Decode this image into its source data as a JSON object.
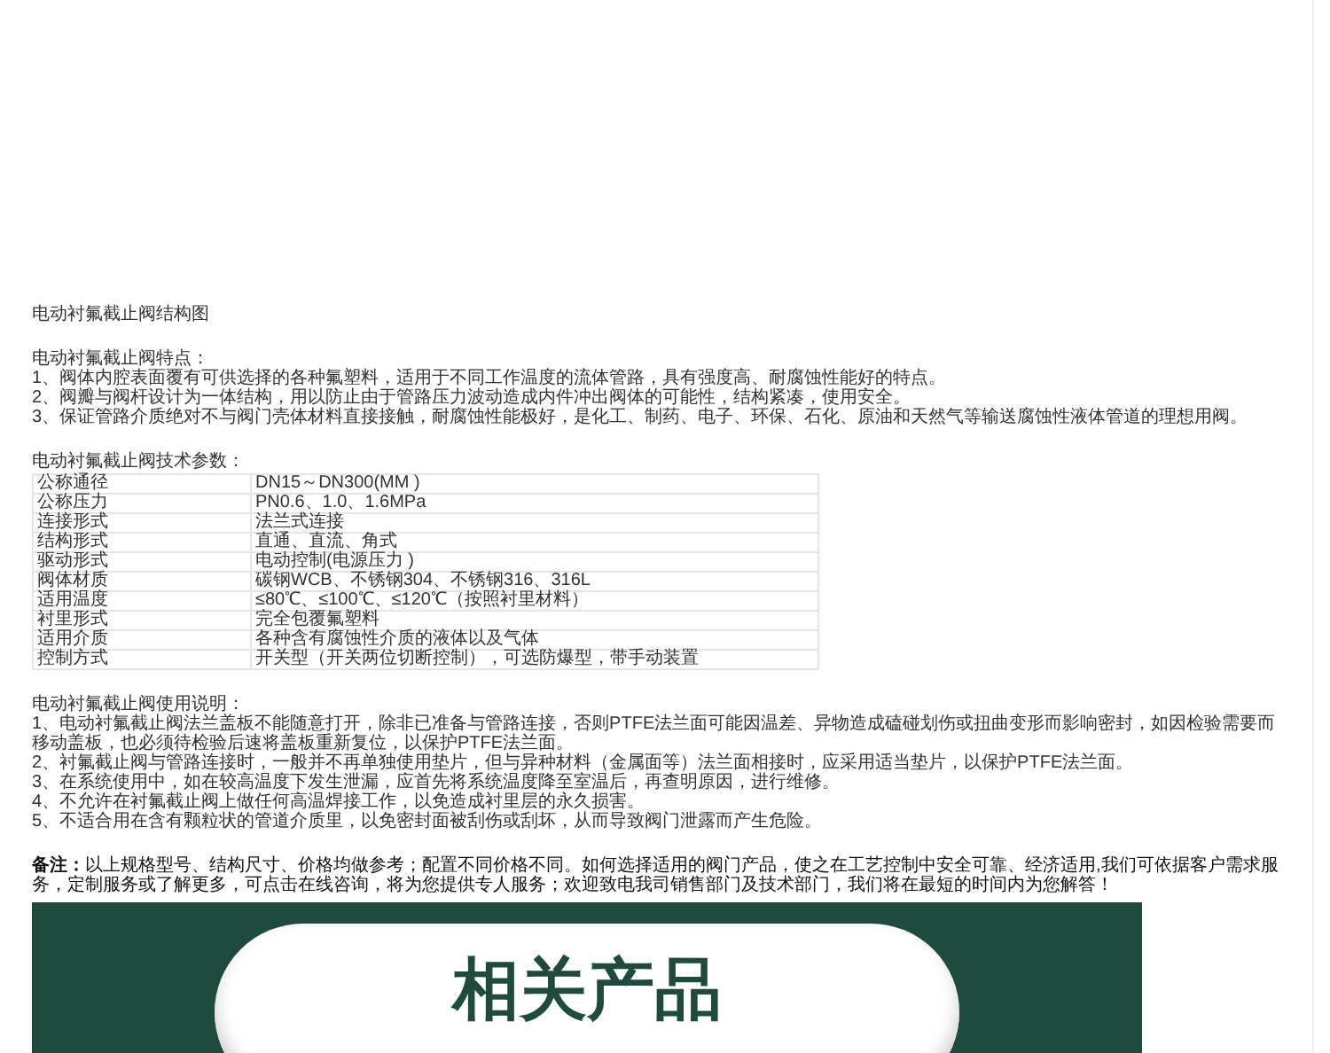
{
  "diagram_heading": "电动衬氟截止阀结构图",
  "features": {
    "title": "电动衬氟截止阀特点：",
    "items": [
      "1、阀体内腔表面覆有可供选择的各种氟塑料，适用于不同工作温度的流体管路，具有强度高、耐腐蚀性能好的特点。",
      "2、阀瓣与阀杆设计为一体结构，用以防止由于管路压力波动造成内件冲出阀体的可能性，结构紧凑，使用安全。",
      "3、保证管路介质绝对不与阀门壳体材料直接接触，耐腐蚀性能极好，是化工、制药、电子、环保、石化、原油和天然气等输送腐蚀性液体管道的理想用阀。"
    ]
  },
  "specs": {
    "title": "电动衬氟截止阀技术参数：",
    "rows": [
      {
        "label": "公称通径",
        "value": "DN15～DN300(MM )"
      },
      {
        "label": "公称压力",
        "value": "PN0.6、1.0、1.6MPa"
      },
      {
        "label": "连接形式",
        "value": "法兰式连接"
      },
      {
        "label": "结构形式",
        "value": "直通、直流、角式"
      },
      {
        "label": "驱动形式",
        "value": "电动控制(电源压力 )"
      },
      {
        "label": "阀体材质",
        "value": "碳钢WCB、不锈钢304、不锈钢316、316L"
      },
      {
        "label": "适用温度",
        "value": "≤80℃、≤100℃、≤120℃（按照衬里材料）"
      },
      {
        "label": "衬里形式",
        "value": "完全包覆氟塑料"
      },
      {
        "label": "适用介质",
        "value": "各种含有腐蚀性介质的液体以及气体"
      },
      {
        "label": "控制方式",
        "value": "开关型（开关两位切断控制），可选防爆型，带手动装置"
      }
    ]
  },
  "usage": {
    "title": "电动衬氟截止阀使用说明：",
    "items": [
      "1、电动衬氟截止阀法兰盖板不能随意打开，除非已准备与管路连接，否则PTFE法兰面可能因温差、异物造成磕碰划伤或扭曲变形而影响密封，如因检验需要而移动盖板，也必须待检验后速将盖板重新复位，以保护PTFE法兰面。",
      "2、衬氟截止阀与管路连接时，一般并不再单独使用垫片，但与异种材料（金属面等）法兰面相接时，应采用适当垫片，以保护PTFE法兰面。",
      "3、在系统使用中，如在较高温度下发生泄漏，应首先将系统温度降至室温后，再查明原因，进行维修。",
      "4、不允许在衬氟截止阀上做任何高温焊接工作，以免造成衬里层的永久损害。",
      "5、不适合用在含有颗粒状的管道介质里，以免密封面被刮伤或刮坏，从而导致阀门泄露而产生危险。"
    ]
  },
  "note": "**备注：**以上规格型号、结构尺寸、价格均做参考；配置不同价格不同。如何选择适用的阀门产品，使之在工艺控制中安全可靠、经济适用,我们可依据客户需求服务，定制服务或了解更多，可点击在线咨询，将为您提供专人服务；欢迎致电我司销售部门及技术部门，我们将在最短的时间内为您解答！",
  "banner": {
    "title": "相关产品"
  }
}
